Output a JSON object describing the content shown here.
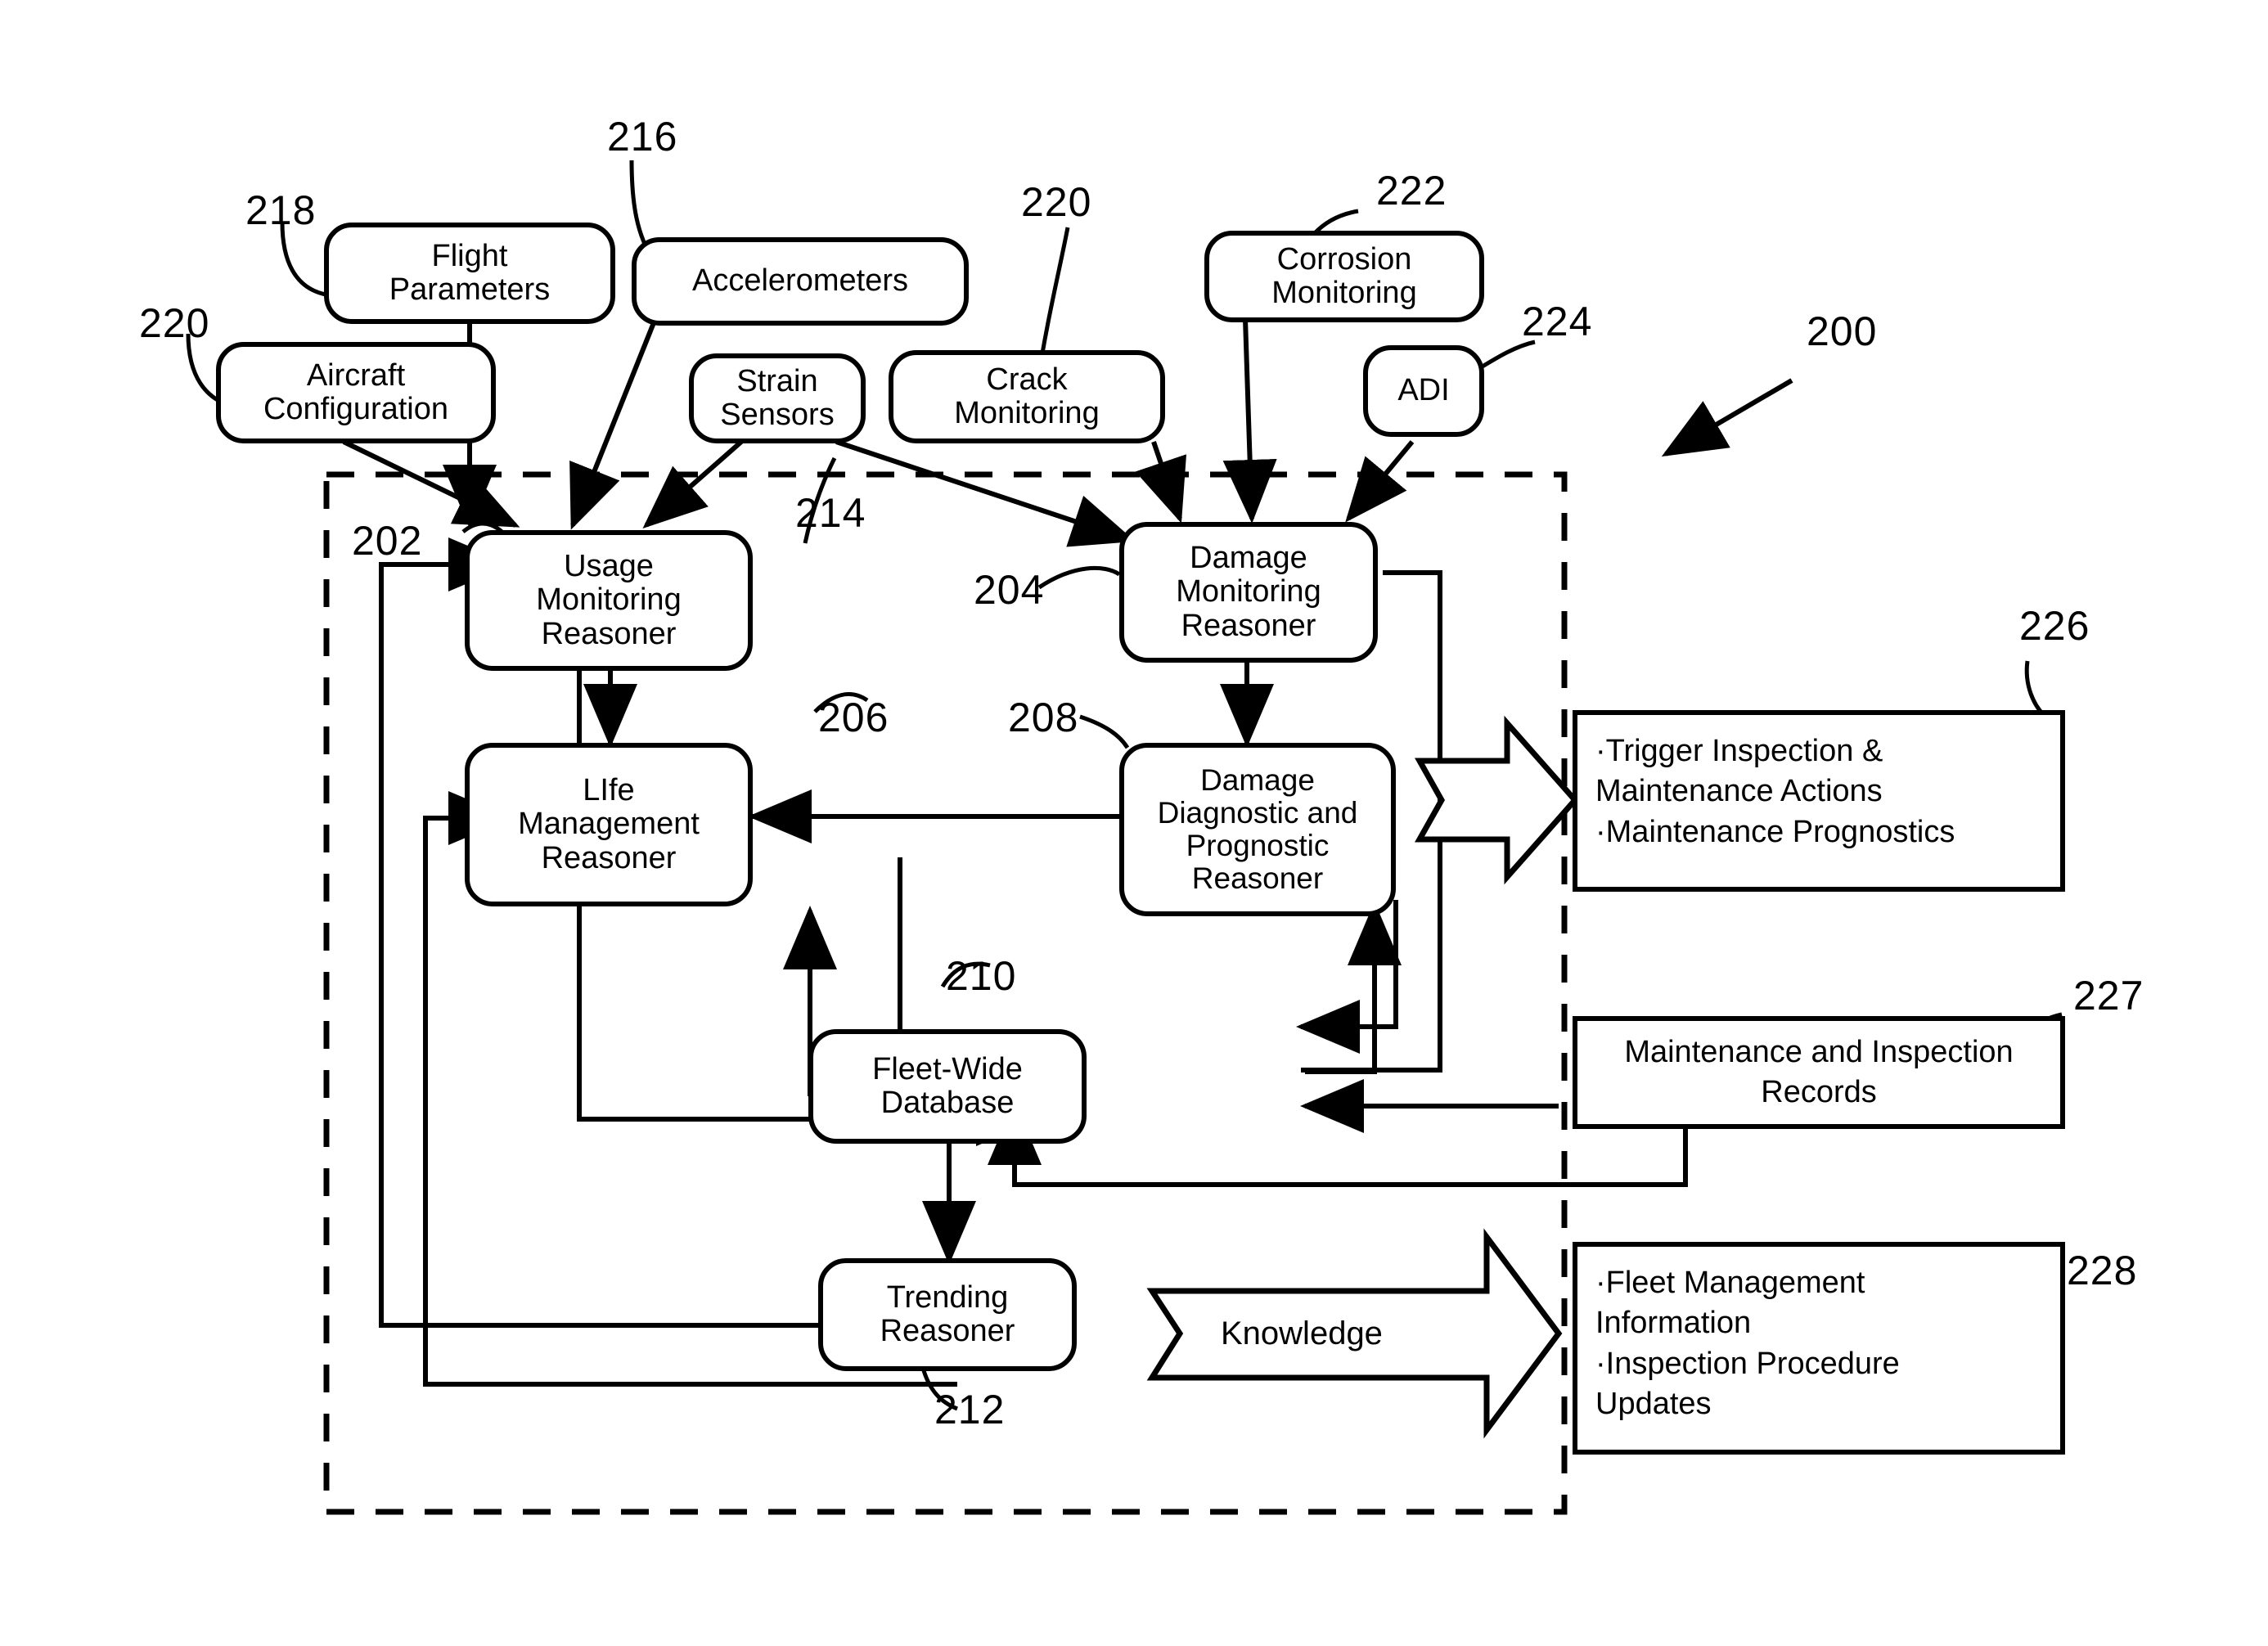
{
  "figure": {
    "system_ref": "200",
    "dashed_boundary_ref": "200"
  },
  "inputs": [
    {
      "id": "flight-parameters",
      "label": "Flight\nParameters",
      "ref": "218"
    },
    {
      "id": "aircraft-configuration",
      "label": "Aircraft\nConfiguration",
      "ref": "220"
    },
    {
      "id": "accelerometers",
      "label": "Accelerometers",
      "ref": "216"
    },
    {
      "id": "strain-sensors",
      "label": "Strain\nSensors",
      "ref": "214"
    },
    {
      "id": "crack-monitoring",
      "label": "Crack\nMonitoring",
      "ref": "220"
    },
    {
      "id": "corrosion-monitoring",
      "label": "Corrosion\nMonitoring",
      "ref": "222"
    },
    {
      "id": "adi",
      "label": "ADI",
      "ref": "224"
    }
  ],
  "reasoners": [
    {
      "id": "usage-monitoring-reasoner",
      "label": "Usage\nMonitoring\nReasoner",
      "ref": "202"
    },
    {
      "id": "damage-monitoring-reasoner",
      "label": "Damage\nMonitoring\nReasoner",
      "ref": "204"
    },
    {
      "id": "life-management-reasoner",
      "label": "LIfe\nManagement\nReasoner",
      "ref": "206"
    },
    {
      "id": "damage-diagnostic-prognostic-reasoner",
      "label": "Damage\nDiagnostic and\nPrognostic\nReasoner",
      "ref": "208"
    },
    {
      "id": "fleet-wide-database",
      "label": "Fleet-Wide\nDatabase",
      "ref": "210"
    },
    {
      "id": "trending-reasoner",
      "label": "Trending\nReasoner",
      "ref": "212"
    }
  ],
  "outputs": [
    {
      "id": "maintenance-actions-box",
      "ref": "226",
      "bullets": "·Trigger Inspection &\nMaintenance Actions\n·Maintenance Prognostics"
    },
    {
      "id": "maintenance-records-box",
      "ref": "227",
      "label": "Maintenance and Inspection\nRecords"
    },
    {
      "id": "fleet-management-box",
      "ref": "228",
      "bullets": "·Fleet Management\nInformation\n·Inspection Procedure\nUpdates"
    }
  ],
  "flow_labels": {
    "knowledge": "Knowledge"
  },
  "refs": {
    "r200": "200",
    "r202": "202",
    "r204": "204",
    "r206": "206",
    "r208": "208",
    "r210": "210",
    "r212": "212",
    "r214": "214",
    "r216": "216",
    "r218": "218",
    "r220a": "220",
    "r220b": "220",
    "r222": "222",
    "r224": "224",
    "r226": "226",
    "r227": "227",
    "r228": "228"
  },
  "colors": {
    "stroke": "#000000",
    "background": "#ffffff"
  }
}
